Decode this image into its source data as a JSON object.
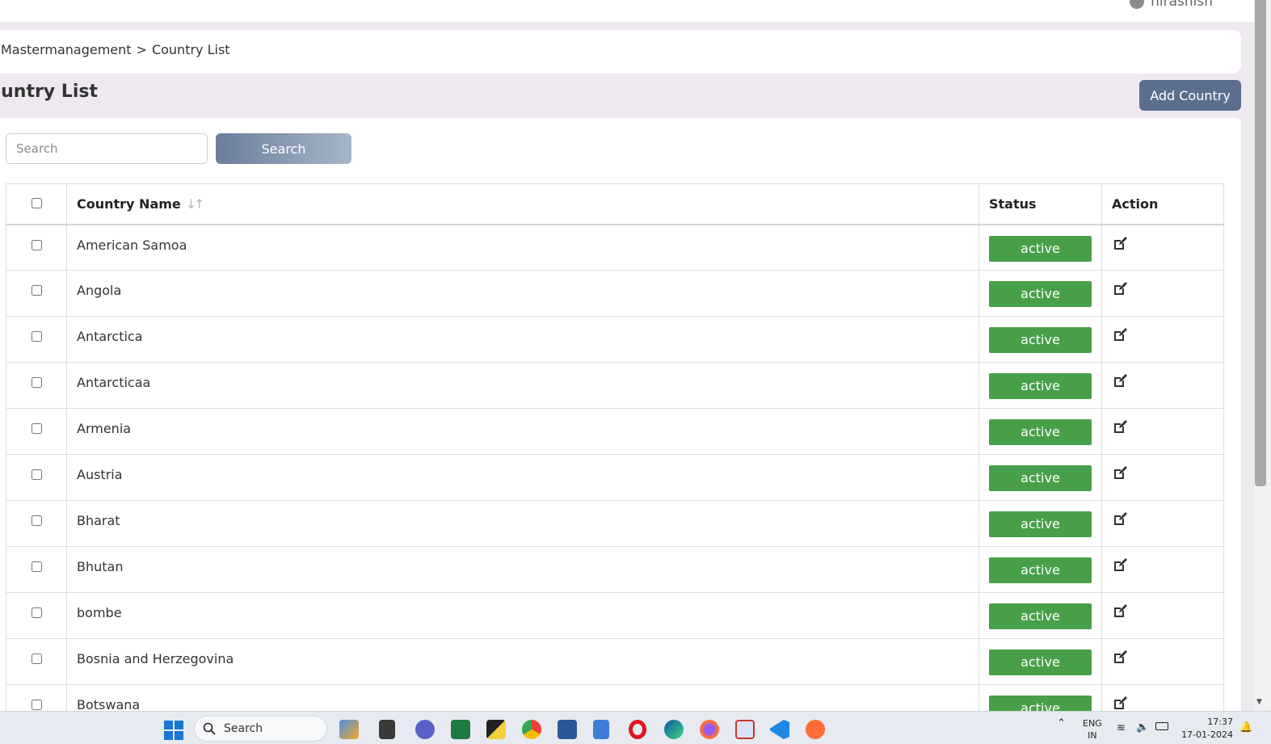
{
  "header": {
    "user_name": "nirashish"
  },
  "breadcrumb": {
    "root": "Mastermanagement",
    "separator": ">",
    "current": "Country List"
  },
  "page": {
    "title": "ountry List",
    "add_button": "Add Country"
  },
  "search": {
    "placeholder": "Search",
    "button": "Search"
  },
  "table": {
    "columns": {
      "name": "Country Name",
      "status": "Status",
      "action": "Action"
    },
    "rows": [
      {
        "name": "American Samoa",
        "status": "active"
      },
      {
        "name": "Angola",
        "status": "active"
      },
      {
        "name": "Antarctica",
        "status": "active"
      },
      {
        "name": "Antarcticaa",
        "status": "active"
      },
      {
        "name": "Armenia",
        "status": "active"
      },
      {
        "name": "Austria",
        "status": "active"
      },
      {
        "name": "Bharat",
        "status": "active"
      },
      {
        "name": "Bhutan",
        "status": "active"
      },
      {
        "name": "bombe",
        "status": "active"
      },
      {
        "name": "Bosnia and Herzegovina",
        "status": "active"
      },
      {
        "name": "Botswana",
        "status": "active"
      }
    ]
  },
  "taskbar": {
    "search": "Search",
    "lang": "ENG",
    "region": "IN",
    "time": "17:37",
    "date": "17-01-2024"
  },
  "colors": {
    "primary_button": "#5b6e8e",
    "active_badge": "#47a049",
    "page_bg": "#efe8f1"
  }
}
